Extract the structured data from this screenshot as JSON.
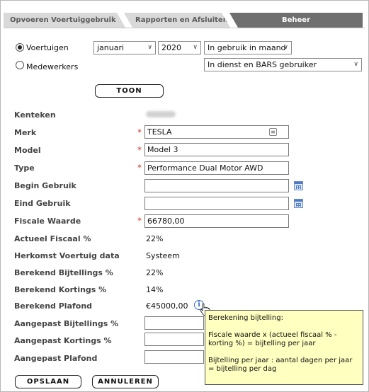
{
  "tabs": [
    {
      "label": "Opvoeren Voertuiggebruik",
      "active": false
    },
    {
      "label": "Rapporten en Afsluiten",
      "active": false
    },
    {
      "label": "Beheer",
      "active": true
    }
  ],
  "filters": {
    "radio_vehicles": "Voertuigen",
    "radio_employees": "Medewerkers",
    "selected_radio": "Voertuigen",
    "month": "januari",
    "year": "2020",
    "usage_filter": "In gebruik in maand",
    "service_filter": "In dienst en BARS gebruiker",
    "show_button": "TOON"
  },
  "form": {
    "kenteken": {
      "label": "Kenteken"
    },
    "merk": {
      "label": "Merk",
      "value": "TESLA"
    },
    "model": {
      "label": "Model",
      "value": "Model 3"
    },
    "type": {
      "label": "Type",
      "value": "Performance Dual Motor AWD"
    },
    "begin_gebruik": {
      "label": "Begin Gebruik",
      "value": ""
    },
    "eind_gebruik": {
      "label": "Eind Gebruik",
      "value": ""
    },
    "fiscale_waarde": {
      "label": "Fiscale Waarde",
      "value": "66780,00"
    },
    "actueel_fiscaal": {
      "label": "Actueel Fiscaal %",
      "value": "22%"
    },
    "herkomst": {
      "label": "Herkomst Voertuig data",
      "value": "Systeem"
    },
    "berekend_bijtelling": {
      "label": "Berekend Bijtellings %",
      "value": "22%"
    },
    "berekend_korting": {
      "label": "Berekend Kortings %",
      "value": "14%"
    },
    "berekend_plafond": {
      "label": "Berekend Plafond",
      "value": "€45000,00"
    },
    "aangepast_bijtelling": {
      "label": "Aangepast Bijtellings %",
      "value": ""
    },
    "aangepast_korting": {
      "label": "Aangepast Kortings %",
      "value": ""
    },
    "aangepast_plafond": {
      "label": "Aangepast Plafond",
      "value": ""
    }
  },
  "tooltip": {
    "title": "Berekening bijtelling:",
    "line1": "Fiscale waarde x (actueel fiscaal % - korting %) = bijtelling per jaar",
    "line2": "Bijtelling per jaar : aantal dagen per jaar = bijtelling per dag"
  },
  "actions": {
    "save": "OPSLAAN",
    "cancel": "ANNULEREN"
  },
  "required_marker": "*",
  "icons": [
    "calendar-icon",
    "info-icon",
    "dropdown-icon",
    "hand-cursor-icon",
    "chevron-down-icon"
  ],
  "colors": {
    "active_tab": "#6f6f6f",
    "inactive_tab": "#d9d9d9",
    "required": "#c0392b",
    "tooltip_bg": "#ffffc0",
    "info_blue": "#3a6fc2"
  }
}
